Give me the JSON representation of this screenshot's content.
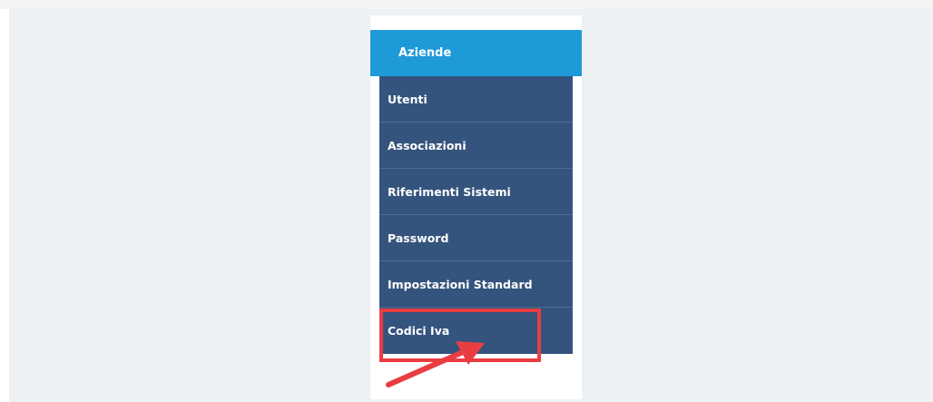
{
  "menu": {
    "active_label": "Aziende",
    "items": [
      {
        "label": "Utenti"
      },
      {
        "label": "Associazioni"
      },
      {
        "label": "Riferimenti Sistemi"
      },
      {
        "label": "Password"
      },
      {
        "label": "Impostazioni Standard"
      },
      {
        "label": "Codici Iva"
      }
    ]
  },
  "colors": {
    "active": "#1e9ad8",
    "menu_background": "#34547d",
    "highlight": "#ea3d42"
  }
}
